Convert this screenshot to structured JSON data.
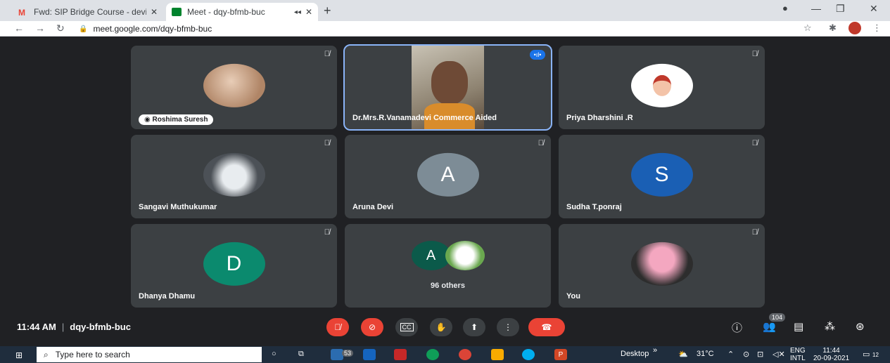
{
  "browser": {
    "tabs": [
      {
        "title": "Fwd: SIP Bridge Course - devipriy",
        "close": "✕"
      },
      {
        "title": "Meet - dqy-bfmb-buc",
        "close": "✕"
      }
    ],
    "new_tab": "+",
    "url": "meet.google.com/dqy-bfmb-buc"
  },
  "tiles": [
    {
      "name": "Roshima Suresh",
      "type": "photo",
      "color": "#d7b49e"
    },
    {
      "name": "Dr.Mrs.R.Vanamadevi Commerce Aided",
      "type": "video"
    },
    {
      "name": "Priya Dharshini .R",
      "type": "photo",
      "color": "#ffffff"
    },
    {
      "name": "Sangavi Muthukumar",
      "type": "photo",
      "color": "#8f949b"
    },
    {
      "name": "Aruna Devi",
      "type": "initial",
      "initial": "A",
      "color": "#7d8c96"
    },
    {
      "name": "Sudha T.ponraj",
      "type": "initial",
      "initial": "S",
      "color": "#1a5fb4"
    },
    {
      "name": "Dhanya Dhamu",
      "type": "initial",
      "initial": "D",
      "color": "#0b8a6e"
    },
    {
      "name": "96 others",
      "type": "others",
      "initial": "A",
      "color": "#0b5a4a"
    },
    {
      "name": "You",
      "type": "photo",
      "color": "#e88aa8"
    }
  ],
  "controls": {
    "time": "11:44 AM",
    "meeting_code": "dqy-bfmb-buc",
    "participants_count": "104"
  },
  "taskbar": {
    "search_placeholder": "Type here to search",
    "mail_count": "53",
    "desktop_label": "Desktop",
    "chevron": "»",
    "weather": "31°C",
    "lang_top": "ENG",
    "lang_bottom": "INTL",
    "clock_time": "11:44",
    "clock_date": "20-09-2021",
    "notif_count": "12"
  }
}
